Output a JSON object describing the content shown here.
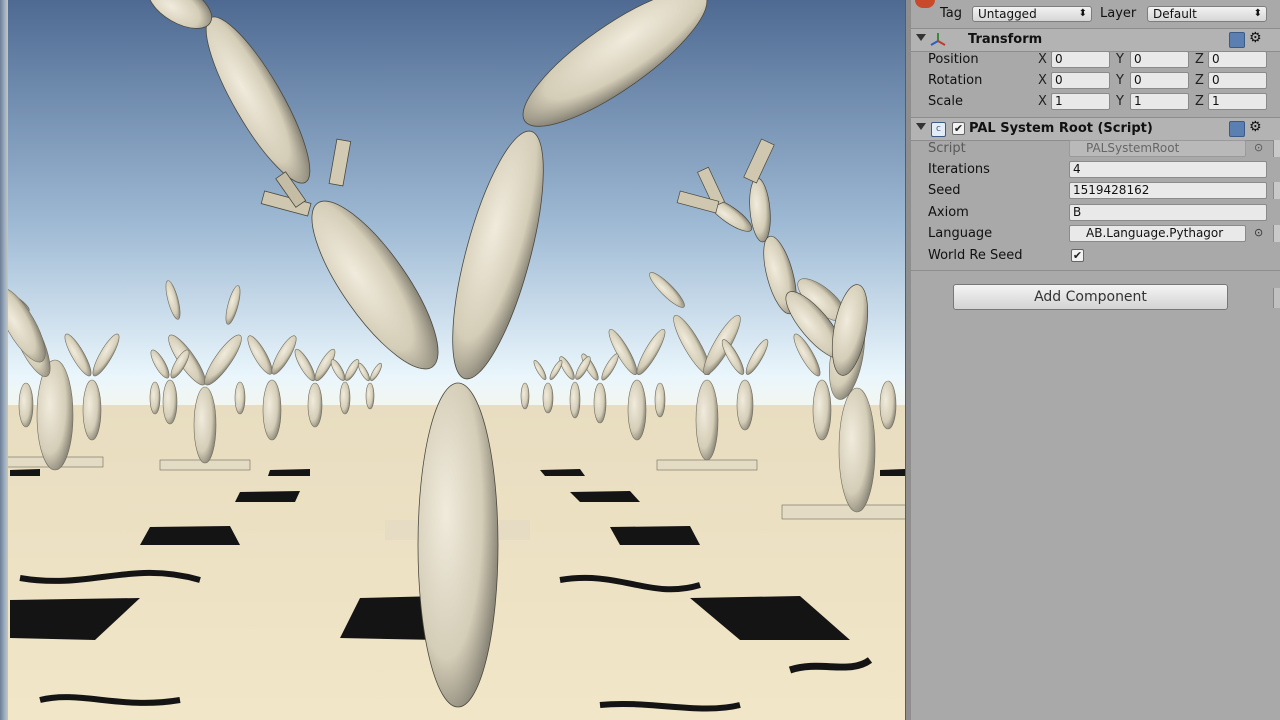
{
  "inspector": {
    "tag_label": "Tag",
    "tag_value": "Untagged",
    "layer_label": "Layer",
    "layer_value": "Default",
    "transform": {
      "title": "Transform",
      "position": {
        "label": "Position",
        "x": "0",
        "y": "0",
        "z": "0"
      },
      "rotation": {
        "label": "Rotation",
        "x": "0",
        "y": "0",
        "z": "0"
      },
      "scale": {
        "label": "Scale",
        "x": "1",
        "y": "1",
        "z": "1"
      }
    },
    "axis_labels": {
      "x": "X",
      "y": "Y",
      "z": "Z"
    },
    "script_component": {
      "title": "PAL System Root (Script)",
      "enabled": true,
      "script_label": "Script",
      "script_value": "PALSystemRoot",
      "iterations_label": "Iterations",
      "iterations_value": "4",
      "seed_label": "Seed",
      "seed_value": "1519428162",
      "axiom_label": "Axiom",
      "axiom_value": "B",
      "language_label": "Language",
      "language_value": "AB.Language.Pythagor",
      "world_re_seed_label": "World Re Seed",
      "world_re_seed_checked": true
    },
    "add_component_label": "Add Component"
  },
  "colors": {
    "sky_top": "#4f6b92",
    "sky_horizon": "#e8f4fb",
    "ground": "#efe3c4",
    "panel": "#a9a9a9"
  }
}
